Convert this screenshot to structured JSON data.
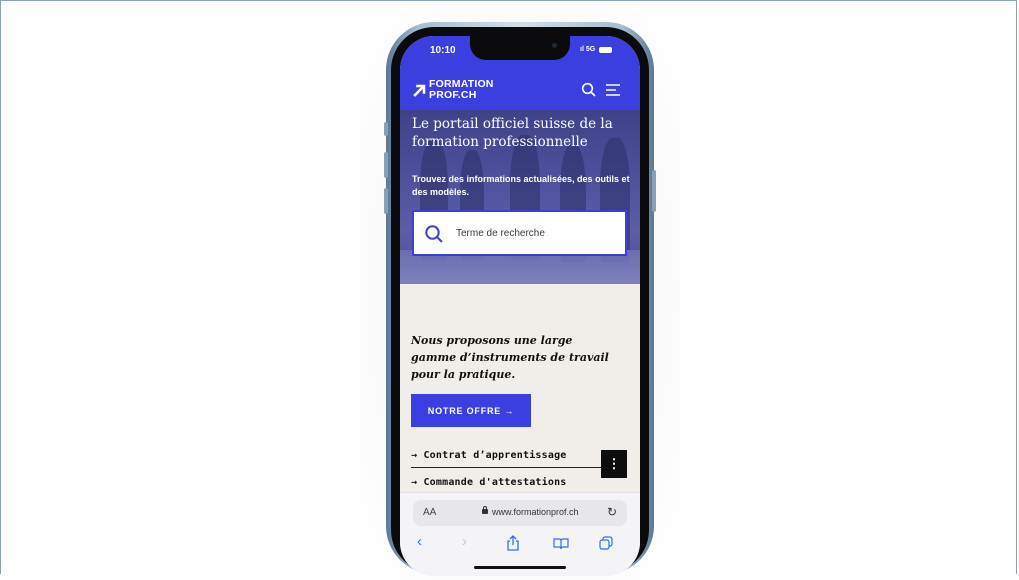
{
  "status_bar": {
    "time": "10:10",
    "network": "5G"
  },
  "header": {
    "logo_line1": "FORMATION",
    "logo_line2": "PROF.CH"
  },
  "hero": {
    "title": "Le portail officiel suisse de la formation professionnelle",
    "subtitle": "Trouvez des informations actualisées, des outils et des modèles.",
    "search_placeholder": "Terme de recherche"
  },
  "main": {
    "intro": "Nous proposons une large gamme d’instruments de travail pour la pratique.",
    "cta_label": "NOTRE OFFRE →",
    "links": [
      {
        "label": "→ Contrat d’apprentissage"
      },
      {
        "label": "→ Commande d'attestations"
      }
    ],
    "kebab_label": "⋮"
  },
  "browser": {
    "text_size": "AA",
    "url": "www.formationprof.ch"
  },
  "colors": {
    "brand": "#3b3fe0",
    "page_bg": "#f1eeea",
    "ios_blue": "#2e6ff0"
  },
  "icons": [
    "search-icon",
    "menu-icon",
    "reload-icon",
    "back-icon",
    "forward-icon",
    "share-icon",
    "bookmarks-icon",
    "tabs-icon",
    "lock-icon"
  ]
}
